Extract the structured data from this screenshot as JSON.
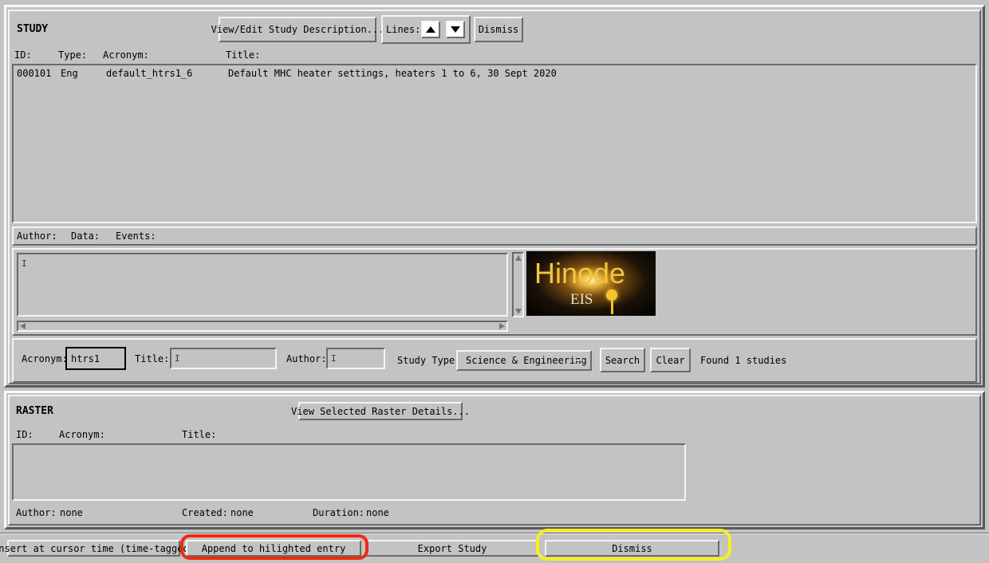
{
  "study": {
    "section_title": "STUDY",
    "view_edit_button": "View/Edit Study Description...",
    "lines_label": "Lines:",
    "dismiss_button": "Dismiss",
    "columns": {
      "id": "ID:",
      "type": "Type:",
      "acronym": "Acronym:",
      "title": "Title:"
    },
    "rows": [
      {
        "id": "000101",
        "type": "Eng",
        "acronym": "default_htrs1_6",
        "title": "Default MHC heater settings, heaters 1 to 6, 30 Sept 2020"
      }
    ],
    "info": {
      "author": "Author:",
      "data": "Data:",
      "events": "Events:"
    },
    "logo": {
      "main": "Hinode",
      "sub": "EIS"
    }
  },
  "search": {
    "acronym_label": "Acronym:",
    "acronym_value": "htrs1",
    "title_label": "Title:",
    "title_value": "",
    "author_label": "Author:",
    "author_value": "",
    "study_type_label": "Study Type:",
    "study_type_value": "Science & Engineering",
    "search_button": "Search",
    "clear_button": "Clear",
    "status": "Found 1 studies"
  },
  "raster": {
    "section_title": "RASTER",
    "view_details_button": "View Selected Raster Details...",
    "columns": {
      "id": "ID:",
      "acronym": "Acronym:",
      "title": "Title:"
    },
    "author_label": "Author:",
    "author_value": "none",
    "created_label": "Created:",
    "created_value": "none",
    "duration_label": "Duration:",
    "duration_value": "none"
  },
  "bottom": {
    "insert_button": "Insert at cursor time (time-tagged)",
    "append_button": "Append to hilighted entry",
    "export_button": "Export Study",
    "dismiss_button": "Dismiss"
  },
  "colors": {
    "highlight_red": "#ee2a12",
    "highlight_yellow": "#f5f020",
    "logo_gold": "#f2c63b"
  }
}
